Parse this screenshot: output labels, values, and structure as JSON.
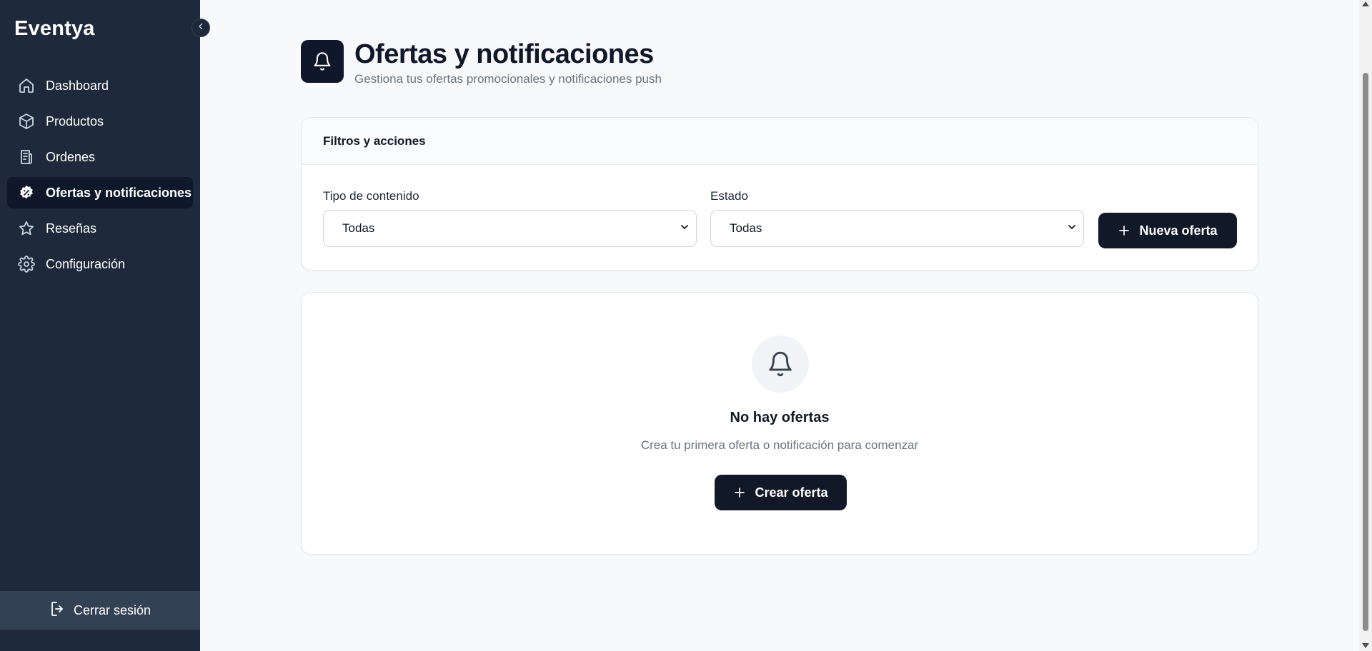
{
  "sidebar": {
    "brand": "Eventya",
    "items": [
      {
        "label": "Dashboard",
        "icon": "home-icon",
        "active": false
      },
      {
        "label": "Productos",
        "icon": "box-icon",
        "active": false
      },
      {
        "label": "Ordenes",
        "icon": "receipt-icon",
        "active": false
      },
      {
        "label": "Ofertas y notificaciones",
        "icon": "badge-percent-icon",
        "active": true
      },
      {
        "label": "Reseñas",
        "icon": "star-icon",
        "active": false
      },
      {
        "label": "Configuración",
        "icon": "gear-icon",
        "active": false
      }
    ],
    "logout_label": "Cerrar sesión"
  },
  "header": {
    "title": "Ofertas y notificaciones",
    "subtitle": "Gestiona tus ofertas promocionales y notificaciones push"
  },
  "filters": {
    "title": "Filtros y acciones",
    "content_type": {
      "label": "Tipo de contenido",
      "value": "Todas"
    },
    "status": {
      "label": "Estado",
      "value": "Todas"
    },
    "new_button_label": "Nueva oferta"
  },
  "empty_state": {
    "title": "No hay ofertas",
    "description": "Crea tu primera oferta o notificación para comenzar",
    "button_label": "Crear oferta"
  },
  "colors": {
    "sidebar_bg": "#1e293b",
    "active_item_bg": "#0f172a",
    "primary_button": "#111827",
    "page_bg": "#f8f9fb"
  }
}
